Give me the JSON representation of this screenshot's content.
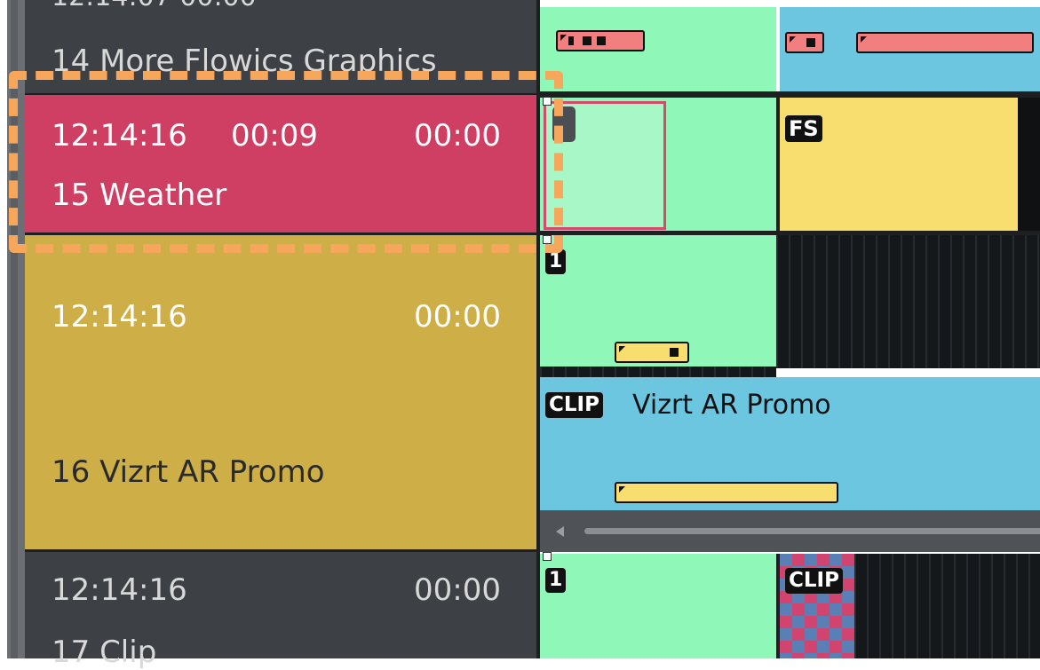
{
  "colors": {
    "row_dark": "#3d4145",
    "row_weather": "#cf3f63",
    "row_promo": "#ceae47",
    "green": "#8ff7b8",
    "blue": "#6dc6df",
    "yellow": "#f8dd6f",
    "selection": "#f6a75b"
  },
  "rows": [
    {
      "id": "14",
      "title": "14 More Flowics Graphics"
    },
    {
      "id": "15",
      "start": "12:14:16",
      "duration": "00:09",
      "remaining": "00:00",
      "title": "15 Weather"
    },
    {
      "id": "16",
      "start": "12:14:16",
      "remaining": "00:00",
      "title": "16 Vizrt AR Promo"
    },
    {
      "id": "17",
      "start": "12:14:16",
      "remaining": "00:00",
      "title": "17 Clip"
    }
  ],
  "timeline": {
    "fs_tag": "FS",
    "layer_tag_1": "1",
    "clip_tag": "CLIP",
    "clip_title": "Vizrt AR Promo",
    "layer_tag_2": "1",
    "clip_tag_2": "CLIP"
  }
}
